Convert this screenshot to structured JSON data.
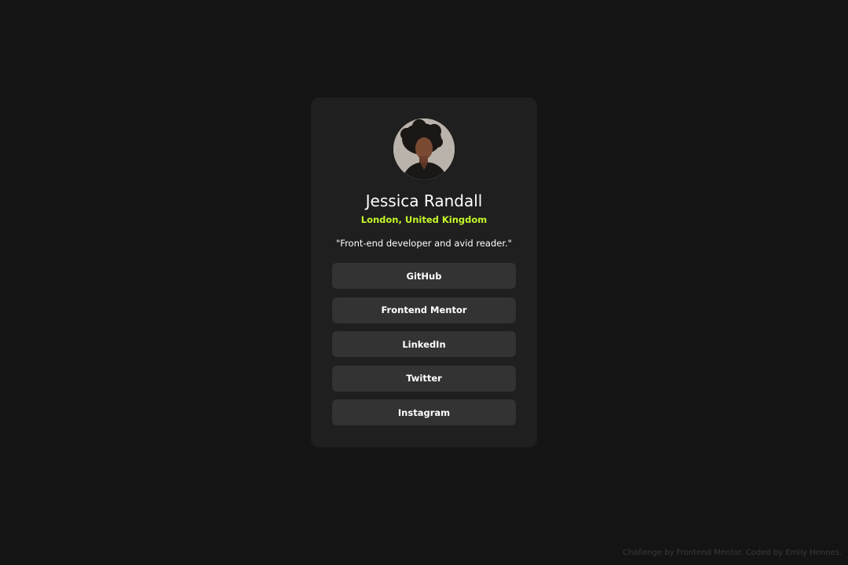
{
  "profile": {
    "name": "Jessica Randall",
    "location": "London, United Kingdom",
    "bio": "\"Front-end developer and avid reader.\"",
    "avatar_icon": "avatar-photo"
  },
  "links": [
    {
      "label": "GitHub"
    },
    {
      "label": "Frontend Mentor"
    },
    {
      "label": "LinkedIn"
    },
    {
      "label": "Twitter"
    },
    {
      "label": "Instagram"
    }
  ],
  "footer": {
    "attribution": "Challenge by Frontend Mentor. Coded by Emily Hennes."
  },
  "colors": {
    "background": "#141414",
    "card": "#1f1f1f",
    "button": "#333333",
    "accent": "#c4f82a",
    "text": "#ffffff"
  }
}
